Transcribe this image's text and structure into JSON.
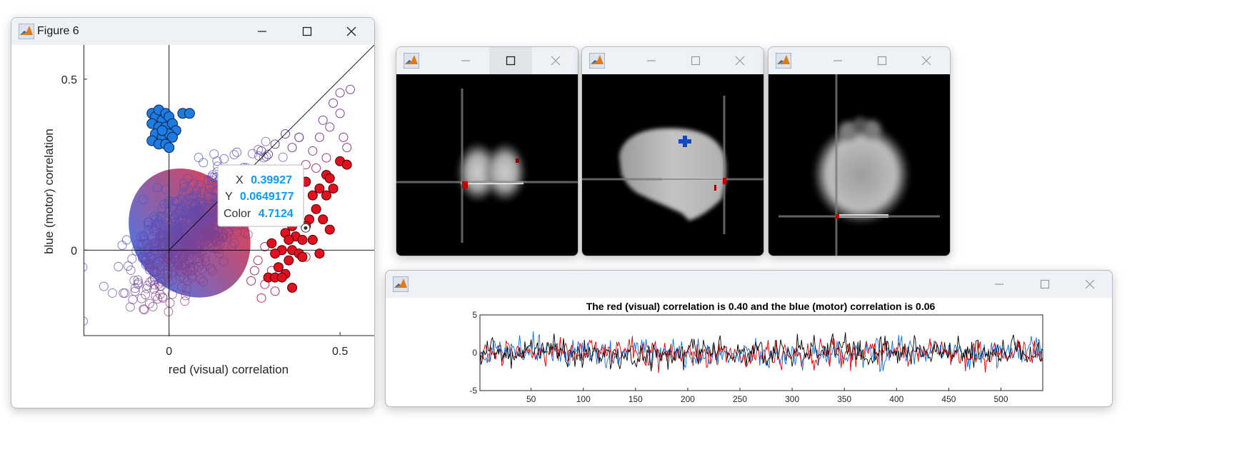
{
  "figure6": {
    "title": "Figure 6",
    "chart_data": {
      "type": "scatter",
      "xlabel": "red (visual) correlation",
      "ylabel": "blue (motor) correlation",
      "xlim": [
        -0.25,
        0.6
      ],
      "ylim": [
        -0.25,
        0.6
      ],
      "xticks": [
        "0",
        "0.5"
      ],
      "yticks": [
        "0",
        "0.5"
      ],
      "cloud_color_low": "#3b5bd6",
      "cloud_color_high": "#d6203a",
      "blue_series": {
        "color": "#1e7be0",
        "points": [
          [
            -0.05,
            0.4
          ],
          [
            -0.04,
            0.39
          ],
          [
            -0.03,
            0.41
          ],
          [
            -0.02,
            0.38
          ],
          [
            -0.01,
            0.4
          ],
          [
            0.0,
            0.39
          ],
          [
            0.04,
            0.4
          ],
          [
            0.06,
            0.4
          ],
          [
            -0.05,
            0.37
          ],
          [
            -0.03,
            0.36
          ],
          [
            -0.01,
            0.36
          ],
          [
            0.01,
            0.37
          ],
          [
            0.02,
            0.35
          ],
          [
            -0.04,
            0.34
          ],
          [
            -0.02,
            0.33
          ],
          [
            0.0,
            0.34
          ],
          [
            0.01,
            0.33
          ],
          [
            -0.05,
            0.32
          ],
          [
            -0.03,
            0.31
          ],
          [
            -0.01,
            0.31
          ],
          [
            0.0,
            0.3
          ],
          [
            -0.02,
            0.35
          ]
        ]
      },
      "red_series": {
        "color": "#e0101e",
        "points": [
          [
            0.5,
            0.26
          ],
          [
            0.52,
            0.25
          ],
          [
            0.46,
            0.22
          ],
          [
            0.47,
            0.21
          ],
          [
            0.44,
            0.18
          ],
          [
            0.46,
            0.16
          ],
          [
            0.48,
            0.18
          ],
          [
            0.4,
            0.2
          ],
          [
            0.42,
            0.16
          ],
          [
            0.43,
            0.12
          ],
          [
            0.45,
            0.09
          ],
          [
            0.47,
            0.06
          ],
          [
            0.41,
            0.09
          ],
          [
            0.38,
            0.13
          ],
          [
            0.36,
            0.07
          ],
          [
            0.37,
            0.04
          ],
          [
            0.39,
            0.03
          ],
          [
            0.34,
            0.05
          ],
          [
            0.35,
            0.03
          ],
          [
            0.42,
            0.03
          ],
          [
            0.44,
            -0.01
          ],
          [
            0.36,
            0.0
          ],
          [
            0.38,
            -0.01
          ],
          [
            0.33,
            0.0
          ],
          [
            0.31,
            -0.01
          ],
          [
            0.35,
            -0.03
          ],
          [
            0.39,
            -0.02
          ],
          [
            0.32,
            -0.05
          ],
          [
            0.34,
            -0.07
          ],
          [
            0.29,
            -0.08
          ],
          [
            0.31,
            -0.08
          ],
          [
            0.33,
            -0.08
          ],
          [
            0.36,
            -0.11
          ],
          [
            0.4,
            0.07
          ],
          [
            0.3,
            0.02
          ]
        ]
      },
      "open_red": [
        [
          0.53,
          0.47
        ],
        [
          0.5,
          0.46
        ],
        [
          0.48,
          0.43
        ],
        [
          0.5,
          0.4
        ],
        [
          0.45,
          0.38
        ],
        [
          0.47,
          0.36
        ],
        [
          0.51,
          0.33
        ],
        [
          0.52,
          0.3
        ],
        [
          0.44,
          0.33
        ],
        [
          0.42,
          0.29
        ],
        [
          0.46,
          0.27
        ],
        [
          0.38,
          0.33
        ],
        [
          0.36,
          0.3
        ],
        [
          0.34,
          0.34
        ],
        [
          0.31,
          0.31
        ],
        [
          0.29,
          0.28
        ],
        [
          0.27,
          0.29
        ],
        [
          0.4,
          0.25
        ],
        [
          0.43,
          0.24
        ],
        [
          0.28,
          0.01
        ],
        [
          0.26,
          -0.03
        ],
        [
          0.25,
          -0.06
        ],
        [
          0.3,
          -0.06
        ],
        [
          0.28,
          -0.1
        ],
        [
          0.31,
          -0.12
        ],
        [
          0.24,
          -0.09
        ],
        [
          0.27,
          -0.14
        ],
        [
          0.4,
          -0.02
        ],
        [
          0.29,
          0.12
        ],
        [
          0.33,
          0.15
        ]
      ],
      "datatip": {
        "x_label": "X",
        "x_value": "0.39927",
        "y_label": "Y",
        "y_value": "0.0649177",
        "c_label": "Color",
        "c_value": "4.7124",
        "value_color": "#0b9cf5"
      }
    }
  },
  "slice_windows": [
    {
      "name": "coronal"
    },
    {
      "name": "sagittal"
    },
    {
      "name": "axial"
    }
  ],
  "timeseries": {
    "chart_data": {
      "type": "line",
      "title": "The red (visual) correlation is 0.40 and the blue (motor) correlation is 0.06",
      "xlim": [
        1,
        540
      ],
      "ylim": [
        -5,
        5
      ],
      "xticks": [
        "50",
        "100",
        "150",
        "200",
        "250",
        "300",
        "350",
        "400",
        "450",
        "500"
      ],
      "yticks": [
        "5",
        "0",
        "-5"
      ],
      "series_colors": [
        "#000000",
        "#e00000",
        "#0a6fe8"
      ]
    }
  }
}
